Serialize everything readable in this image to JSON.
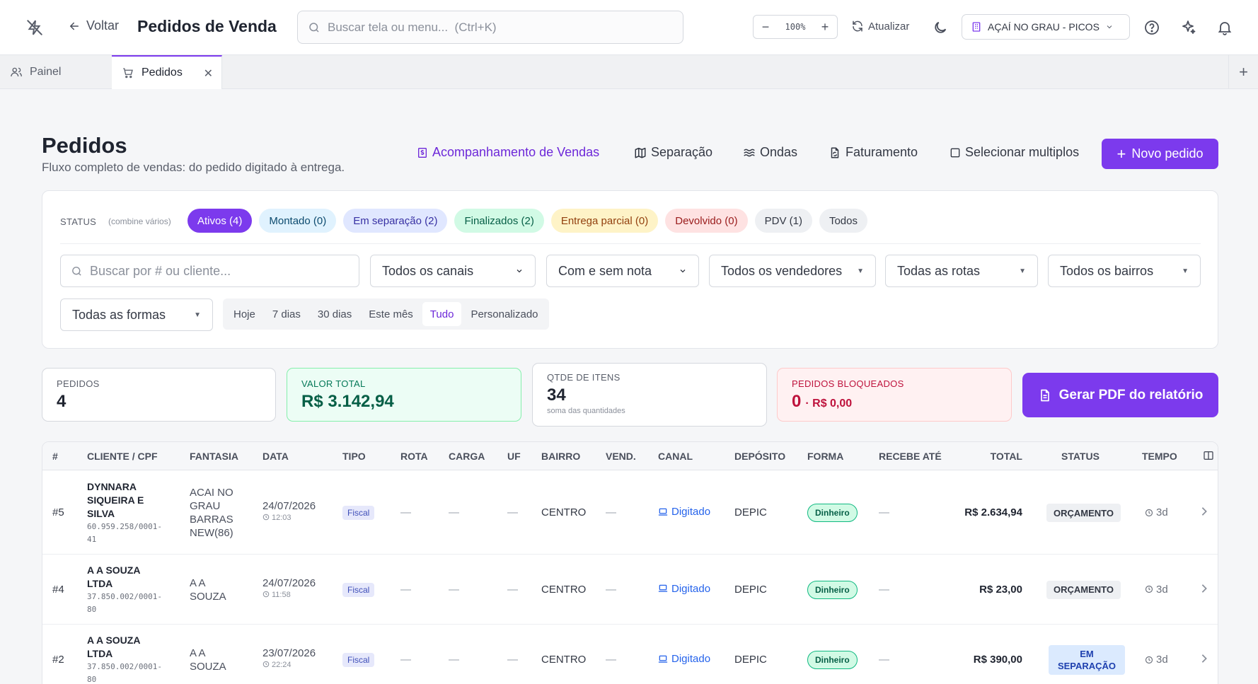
{
  "topbar": {
    "back_label": "Voltar",
    "title": "Pedidos de Venda",
    "search_placeholder": "Buscar tela ou menu...  (Ctrl+K)",
    "zoom": "100%",
    "refresh_label": "Atualizar",
    "company": "AÇAÍ NO GRAU - PICOS"
  },
  "tabs": [
    {
      "label": "Painel"
    },
    {
      "label": "Pedidos"
    }
  ],
  "page": {
    "title": "Pedidos",
    "subtitle": "Fluxo completo de vendas: do pedido digitado à entrega.",
    "actions": [
      "Acompanhamento de Vendas",
      "Separação",
      "Ondas",
      "Faturamento",
      "Selecionar multiplos"
    ],
    "new_button": "Novo pedido"
  },
  "filters": {
    "status_label": "STATUS",
    "status_hint": "(combine vários)",
    "chips": [
      {
        "label": "Ativos (4)",
        "bg": "#7c3aed",
        "fg": "#ffffff"
      },
      {
        "label": "Montado (0)",
        "bg": "#e0f2fe",
        "fg": "#0c4a6e"
      },
      {
        "label": "Em separação (2)",
        "bg": "#e0e7ff",
        "fg": "#3730a3"
      },
      {
        "label": "Finalizados (2)",
        "bg": "#d1fae5",
        "fg": "#065f46"
      },
      {
        "label": "Entrega parcial (0)",
        "bg": "#fef3c7",
        "fg": "#92400e"
      },
      {
        "label": "Devolvido (0)",
        "bg": "#fee2e2",
        "fg": "#991b1b"
      },
      {
        "label": "PDV (1)",
        "bg": "#eef0f3",
        "fg": "#333844"
      },
      {
        "label": "Todos",
        "bg": "#eef0f3",
        "fg": "#333844"
      }
    ],
    "search_placeholder": "Buscar por # ou cliente...",
    "canais": "Todos os canais",
    "nota": "Com e sem nota",
    "vendedores": "Todos os vendedores",
    "rotas": "Todas as rotas",
    "bairros": "Todos os bairros",
    "formas": "Todas as formas",
    "dates": [
      "Hoje",
      "7 dias",
      "30 dias",
      "Este mês",
      "Tudo",
      "Personalizado"
    ],
    "date_active": "Tudo"
  },
  "stats": {
    "pedidos_label": "PEDIDOS",
    "pedidos_value": "4",
    "valor_label": "VALOR TOTAL",
    "valor_value": "R$ 3.142,94",
    "qtde_label": "QTDE DE ITENS",
    "qtde_value": "34",
    "qtde_sub": "soma das quantidades",
    "bloq_label": "PEDIDOS BLOQUEADOS",
    "bloq_value": "0",
    "bloq_amount": "· R$ 0,00",
    "pdf_button": "Gerar PDF do relatório"
  },
  "table": {
    "headers": [
      "#",
      "CLIENTE / CPF",
      "FANTASIA",
      "DATA",
      "TIPO",
      "ROTA",
      "CARGA",
      "UF",
      "BAIRRO",
      "VEND.",
      "CANAL",
      "DEPÓSITO",
      "FORMA",
      "RECEBE ATÉ",
      "TOTAL",
      "STATUS",
      "TEMPO"
    ],
    "rows": [
      {
        "id": "#5",
        "cliente": [
          "DYNNARA",
          "SIQUEIRA E",
          "SILVA"
        ],
        "doc": [
          "60.959.258/0001-",
          "41"
        ],
        "fantasia": [
          "ACAI NO",
          "GRAU",
          "BARRAS",
          "NEW(86)"
        ],
        "data": "24/07/2026",
        "hora": "12:03",
        "tipo": "Fiscal",
        "rota": "—",
        "carga": "—",
        "uf": "—",
        "bairro": "CENTRO",
        "vend": "—",
        "canal": "Digitado",
        "deposito": "DEPIC",
        "forma": "Dinheiro",
        "recebe": "—",
        "total": "R$ 2.634,94",
        "status": "ORÇAMENTO",
        "tempo": "3d"
      },
      {
        "id": "#4",
        "cliente": [
          "A A SOUZA",
          "LTDA"
        ],
        "doc": [
          "37.850.002/0001-",
          "80"
        ],
        "fantasia": [
          "A A",
          "SOUZA"
        ],
        "data": "24/07/2026",
        "hora": "11:58",
        "tipo": "Fiscal",
        "rota": "—",
        "carga": "—",
        "uf": "—",
        "bairro": "CENTRO",
        "vend": "—",
        "canal": "Digitado",
        "deposito": "DEPIC",
        "forma": "Dinheiro",
        "recebe": "—",
        "total": "R$ 23,00",
        "status": "ORÇAMENTO",
        "tempo": "3d"
      },
      {
        "id": "#2",
        "cliente": [
          "A A SOUZA",
          "LTDA"
        ],
        "doc": [
          "37.850.002/0001-",
          "80"
        ],
        "fantasia": [
          "A A",
          "SOUZA"
        ],
        "data": "23/07/2026",
        "hora": "22:24",
        "tipo": "Fiscal",
        "rota": "—",
        "carga": "—",
        "uf": "—",
        "bairro": "CENTRO",
        "vend": "—",
        "canal": "Digitado",
        "deposito": "DEPIC",
        "forma": "Dinheiro",
        "recebe": "—",
        "total": "R$ 390,00",
        "status": [
          "EM",
          "SEPARAÇÃO"
        ],
        "tempo": "3d"
      }
    ]
  }
}
